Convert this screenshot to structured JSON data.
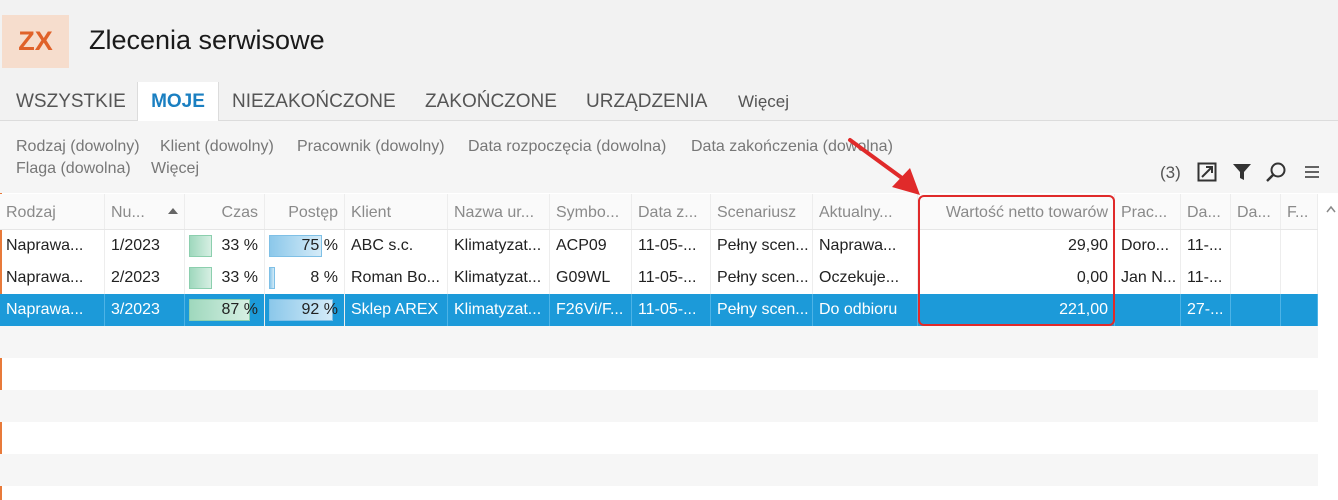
{
  "app": {
    "badge": "ZX",
    "title": "Zlecenia serwisowe"
  },
  "tabs": [
    {
      "label": "WSZYSTKIE"
    },
    {
      "label": "MOJE"
    },
    {
      "label": "NIEZAKOŃCZONE"
    },
    {
      "label": "ZAKOŃCZONE"
    },
    {
      "label": "URZĄDZENIA"
    },
    {
      "label": "Więcej"
    }
  ],
  "filters": [
    "Rodzaj (dowolny)",
    "Klient (dowolny)",
    "Pracownik (dowolny)",
    "Data rozpoczęcia (dowolna)",
    "Data zakończenia (dowolna)",
    "Flaga (dowolna)",
    "Więcej"
  ],
  "toolbar": {
    "count": "(3)"
  },
  "columns": [
    "Rodzaj",
    "Nu...",
    "Czas",
    "Postęp",
    "Klient",
    "Nazwa ur...",
    "Symbo...",
    "Data z...",
    "Scenariusz",
    "Aktualny...",
    "Wartość netto towarów",
    "Prac...",
    "Da...",
    "Da...",
    "F..."
  ],
  "rows": [
    {
      "rodzaj": "Naprawa...",
      "numer": "1/2023",
      "czas": "33 %",
      "czas_value": 33,
      "postep": "75 %",
      "postep_value": 75,
      "klient": "ABC s.c.",
      "nazwa": "Klimatyzat...",
      "symbol": "ACP09",
      "data_z": "11-05-...",
      "scenariusz": "Pełny scen...",
      "aktualny": "Naprawa...",
      "wartosc": "29,90",
      "prac": "Doro...",
      "da1": "11-...",
      "da2": "",
      "f": ""
    },
    {
      "rodzaj": "Naprawa...",
      "numer": "2/2023",
      "czas": "33 %",
      "czas_value": 33,
      "postep": "8 %",
      "postep_value": 8,
      "klient": "Roman Bo...",
      "nazwa": "Klimatyzat...",
      "symbol": "G09WL",
      "data_z": "11-05-...",
      "scenariusz": "Pełny scen...",
      "aktualny": "Oczekuje...",
      "wartosc": "0,00",
      "prac": "Jan N...",
      "da1": "11-...",
      "da2": "",
      "f": ""
    },
    {
      "rodzaj": "Naprawa...",
      "numer": "3/2023",
      "czas": "87 %",
      "czas_value": 87,
      "postep": "92 %",
      "postep_value": 92,
      "klient": "Sklep AREX",
      "nazwa": "Klimatyzat...",
      "symbol": "F26Vi/F...",
      "data_z": "11-05-...",
      "scenariusz": "Pełny scen...",
      "aktualny": "Do odbioru",
      "wartosc": "221,00",
      "prac": "",
      "da1": "27-...",
      "da2": "",
      "f": ""
    }
  ],
  "colors": {
    "accent": "#1a7fc1",
    "selection": "#1c9ad9",
    "brand": "#e0622a",
    "annotation": "#e02a2a"
  }
}
